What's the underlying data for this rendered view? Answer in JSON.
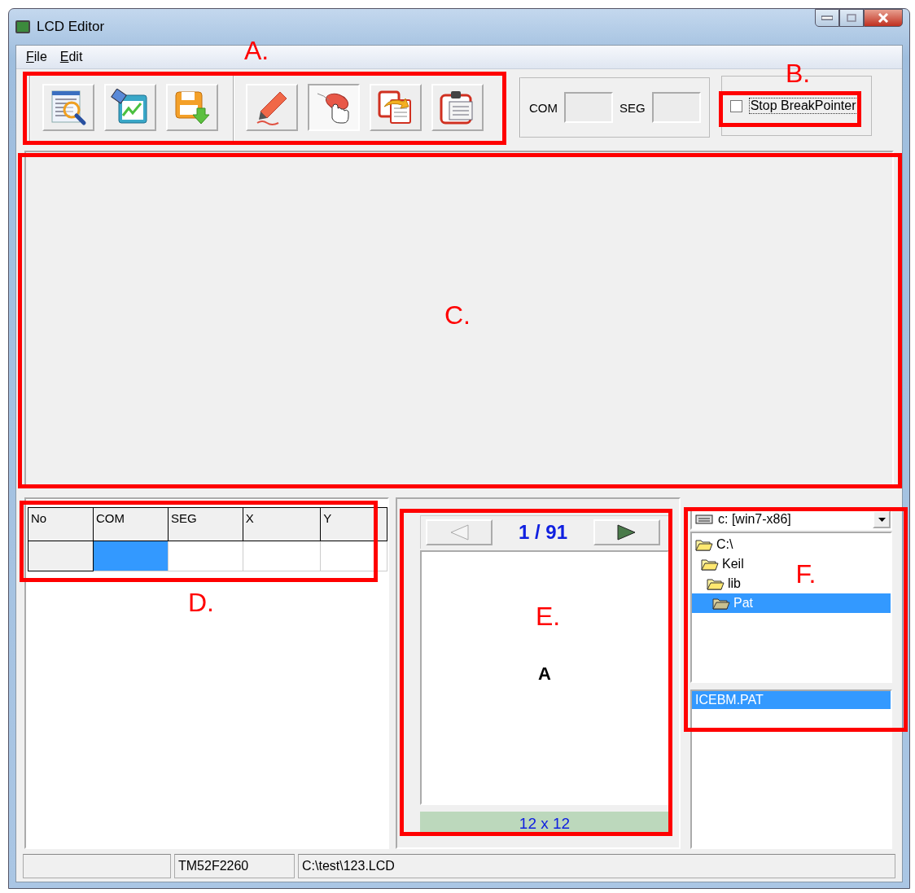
{
  "window": {
    "title": "LCD Editor"
  },
  "menu": [
    {
      "label": "File"
    },
    {
      "label": "Edit"
    }
  ],
  "toolbar": {
    "groups": [
      [
        {
          "kind": "find",
          "pressed": false
        },
        {
          "kind": "chart",
          "pressed": false
        },
        {
          "kind": "save",
          "pressed": false
        }
      ],
      [
        {
          "kind": "pen",
          "pressed": false
        },
        {
          "kind": "mouse",
          "pressed": true
        },
        {
          "kind": "copy",
          "pressed": false
        },
        {
          "kind": "paste",
          "pressed": false
        }
      ]
    ],
    "com_label": "COM",
    "seg_label": "SEG"
  },
  "breakpoint": {
    "label": "Stop BreakPointer",
    "checked": false
  },
  "grid": {
    "columns": [
      "No",
      "COM",
      "SEG",
      "X",
      "Y"
    ],
    "rows": [
      {
        "cells": [
          {
            "selected": false
          },
          {
            "selected": true
          },
          {
            "selected": false
          },
          {
            "selected": false
          },
          {
            "selected": false
          }
        ]
      }
    ]
  },
  "pattern": {
    "counter": "1 / 91",
    "prev_enabled": false,
    "next_enabled": true,
    "glyph": "A",
    "size": "12 x 12"
  },
  "files": {
    "drive": "c: [win7-x86]",
    "folders": [
      {
        "name": "C:\\",
        "selected": false,
        "children": [
          {
            "name": "Keil",
            "selected": false,
            "children": [
              {
                "name": "lib",
                "selected": false,
                "children": [
                  {
                    "name": "Pat",
                    "selected": true
                  }
                ]
              }
            ]
          }
        ]
      }
    ],
    "list": [
      {
        "name": "ICEBM.PAT",
        "selected": true
      }
    ]
  },
  "status_bar": [
    "TM52F2260",
    "C:\\test\\123.LCD"
  ],
  "annotations": [
    {
      "label": "A."
    },
    {
      "label": "B."
    },
    {
      "label": "C."
    },
    {
      "label": "D."
    },
    {
      "label": "E."
    },
    {
      "label": "F."
    }
  ]
}
